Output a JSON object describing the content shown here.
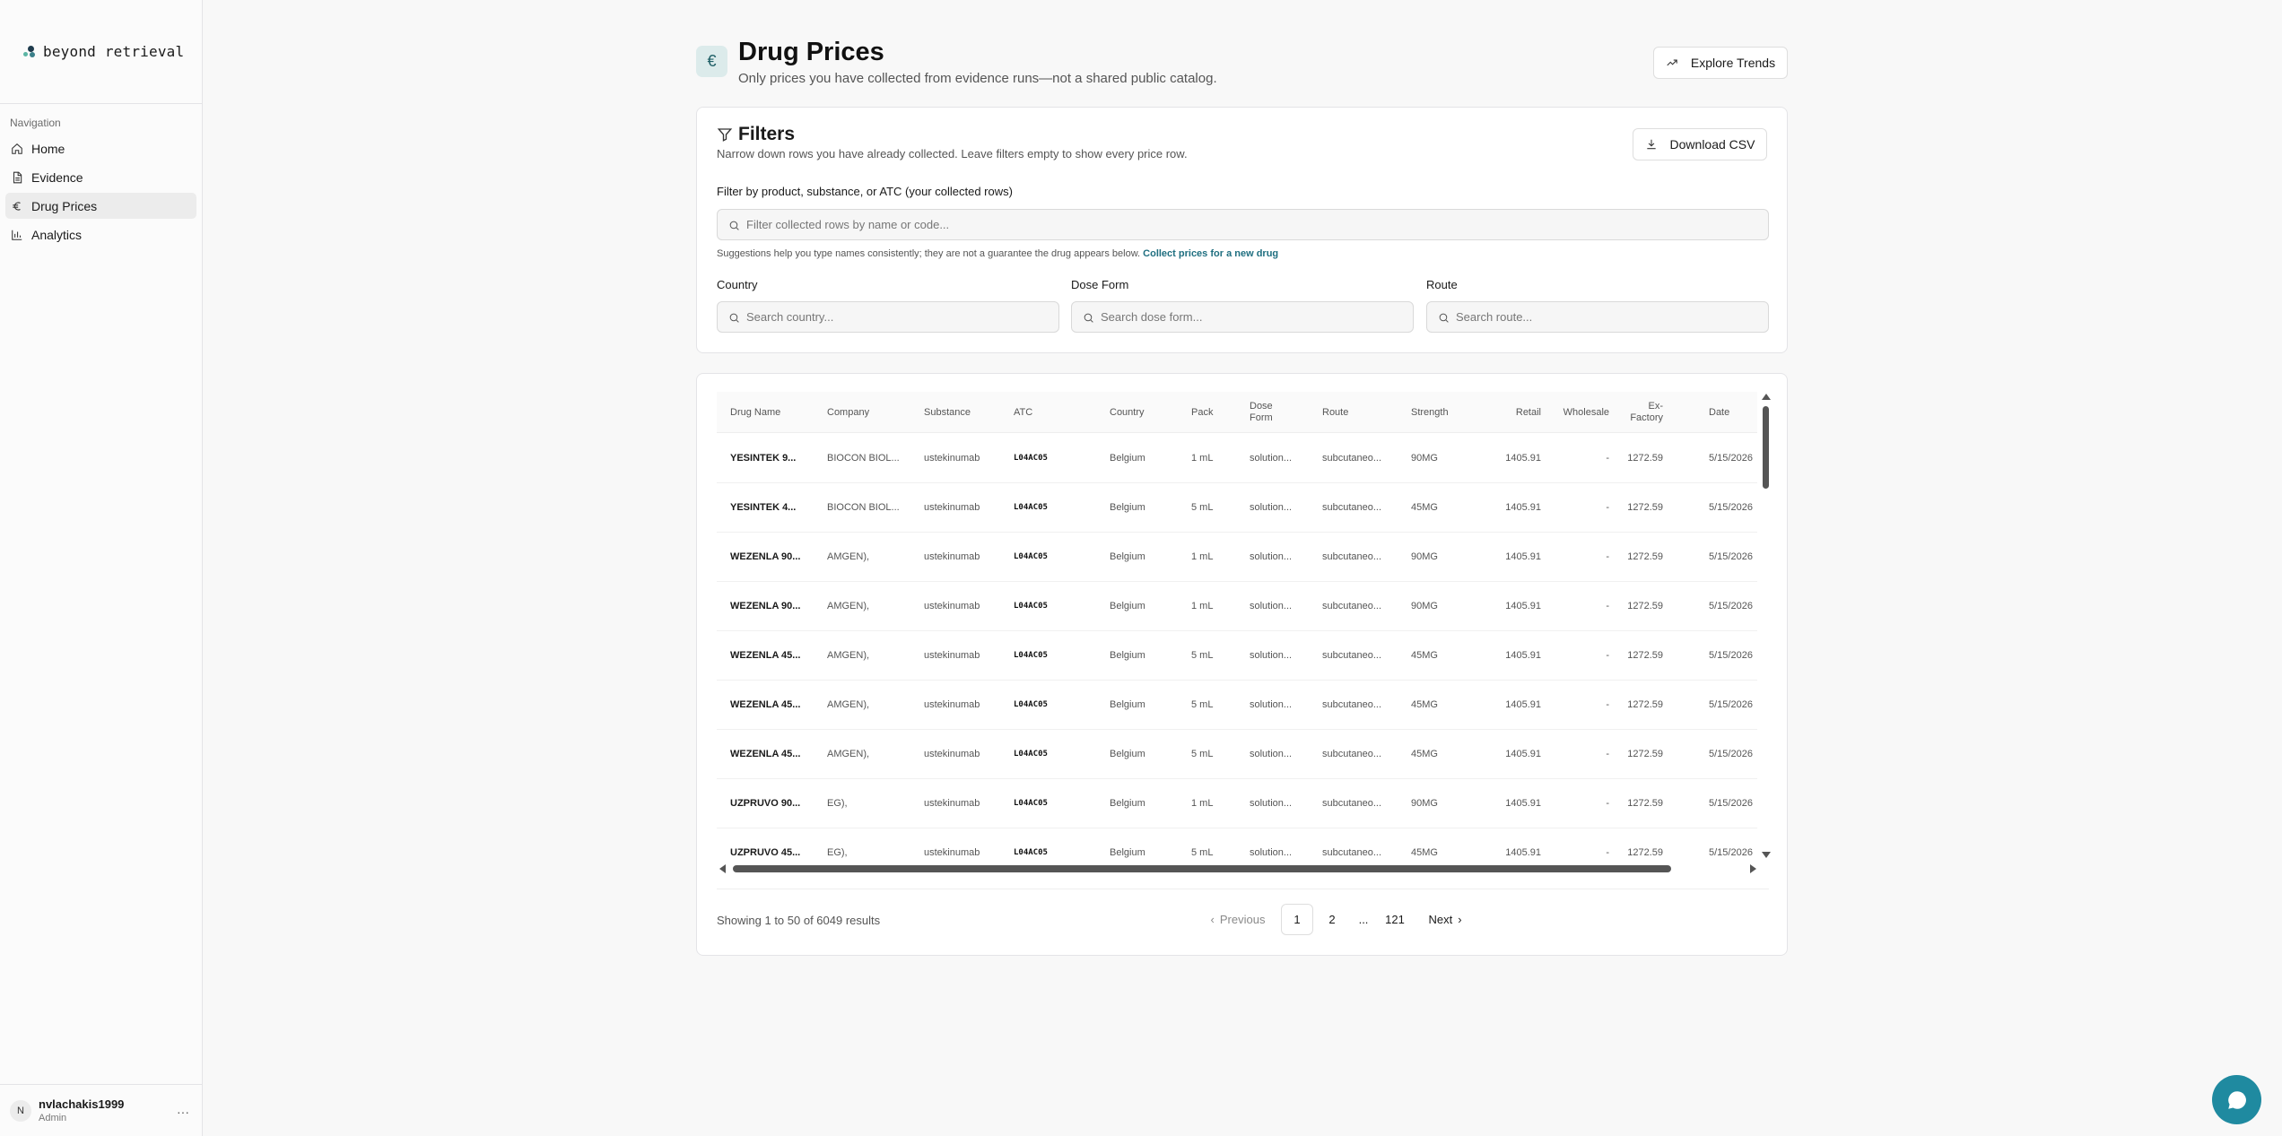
{
  "app": {
    "logo_text": "beyond retrieval"
  },
  "sidebar": {
    "nav_title": "Navigation",
    "items": [
      {
        "label": "Home",
        "icon": "home-icon"
      },
      {
        "label": "Evidence",
        "icon": "document-icon"
      },
      {
        "label": "Drug Prices",
        "icon": "euro-icon"
      },
      {
        "label": "Analytics",
        "icon": "bar-chart-icon"
      }
    ],
    "active_index": 2
  },
  "user": {
    "initial": "N",
    "name": "nvlachakis1999",
    "role": "Admin",
    "more": "···"
  },
  "header": {
    "icon_glyph": "€",
    "title": "Drug Prices",
    "subtitle": "Only prices you have collected from evidence runs—not a shared public catalog.",
    "explore_label": "Explore Trends"
  },
  "filters": {
    "title": "Filters",
    "description": "Narrow down rows you have already collected. Leave filters empty to show every price row.",
    "download_label": "Download CSV",
    "product_label": "Filter by product, substance, or ATC (your collected rows)",
    "product_placeholder": "Filter collected rows by name or code...",
    "hint_text": "Suggestions help you type names consistently; they are not a guarantee the drug appears below.",
    "hint_link": "Collect prices for a new drug",
    "country_label": "Country",
    "country_placeholder": "Search country...",
    "dose_label": "Dose Form",
    "dose_placeholder": "Search dose form...",
    "route_label": "Route",
    "route_placeholder": "Search route..."
  },
  "table": {
    "columns": [
      "Drug Name",
      "Company",
      "Substance",
      "ATC",
      "Country",
      "Pack",
      "Dose Form",
      "Route",
      "Strength",
      "Retail",
      "Wholesale",
      "Ex-Factory",
      "Date"
    ],
    "rows": [
      [
        "YESINTEK 9...",
        "BIOCON BIOL...",
        "ustekinumab",
        "L04AC05",
        "Belgium",
        "1 mL",
        "solution...",
        "subcutaneo...",
        "90MG",
        "1405.91",
        "-",
        "1272.59",
        "5/15/2026"
      ],
      [
        "YESINTEK 4...",
        "BIOCON BIOL...",
        "ustekinumab",
        "L04AC05",
        "Belgium",
        "5 mL",
        "solution...",
        "subcutaneo...",
        "45MG",
        "1405.91",
        "-",
        "1272.59",
        "5/15/2026"
      ],
      [
        "WEZENLA 90...",
        "AMGEN),",
        "ustekinumab",
        "L04AC05",
        "Belgium",
        "1 mL",
        "solution...",
        "subcutaneo...",
        "90MG",
        "1405.91",
        "-",
        "1272.59",
        "5/15/2026"
      ],
      [
        "WEZENLA 90...",
        "AMGEN),",
        "ustekinumab",
        "L04AC05",
        "Belgium",
        "1 mL",
        "solution...",
        "subcutaneo...",
        "90MG",
        "1405.91",
        "-",
        "1272.59",
        "5/15/2026"
      ],
      [
        "WEZENLA 45...",
        "AMGEN),",
        "ustekinumab",
        "L04AC05",
        "Belgium",
        "5 mL",
        "solution...",
        "subcutaneo...",
        "45MG",
        "1405.91",
        "-",
        "1272.59",
        "5/15/2026"
      ],
      [
        "WEZENLA 45...",
        "AMGEN),",
        "ustekinumab",
        "L04AC05",
        "Belgium",
        "5 mL",
        "solution...",
        "subcutaneo...",
        "45MG",
        "1405.91",
        "-",
        "1272.59",
        "5/15/2026"
      ],
      [
        "WEZENLA 45...",
        "AMGEN),",
        "ustekinumab",
        "L04AC05",
        "Belgium",
        "5 mL",
        "solution...",
        "subcutaneo...",
        "45MG",
        "1405.91",
        "-",
        "1272.59",
        "5/15/2026"
      ],
      [
        "UZPRUVO 90...",
        "EG),",
        "ustekinumab",
        "L04AC05",
        "Belgium",
        "1 mL",
        "solution...",
        "subcutaneo...",
        "90MG",
        "1405.91",
        "-",
        "1272.59",
        "5/15/2026"
      ],
      [
        "UZPRUVO 45...",
        "EG),",
        "ustekinumab",
        "L04AC05",
        "Belgium",
        "5 mL",
        "solution...",
        "subcutaneo...",
        "45MG",
        "1405.91",
        "-",
        "1272.59",
        "5/15/2026"
      ]
    ]
  },
  "pagination": {
    "summary": "Showing 1 to 50 of 6049 results",
    "previous": "Previous",
    "pages": [
      "1",
      "2",
      "...",
      "121"
    ],
    "next": "Next",
    "current": "1"
  },
  "colors": {
    "accent": "#1f8aa0",
    "header_icon_bg": "#dcebeb"
  }
}
